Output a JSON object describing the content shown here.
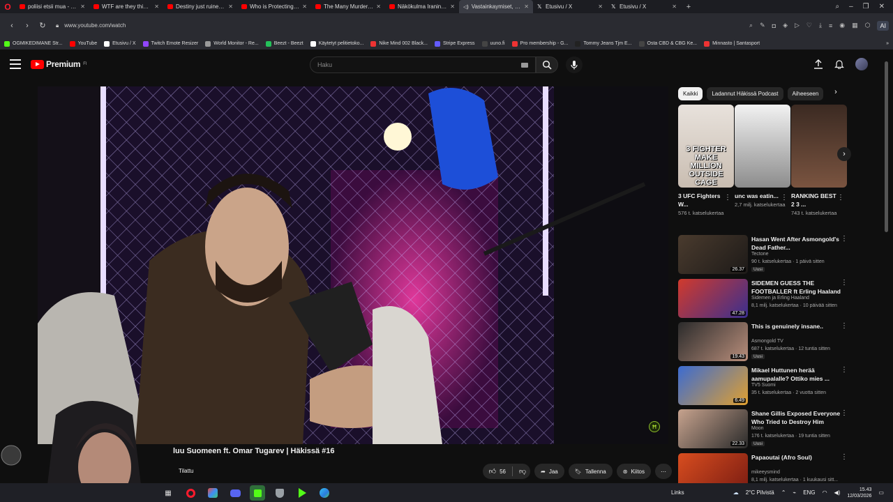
{
  "browser": {
    "tabs": [
      {
        "title": "poliisi etsii mua - YouTube",
        "icon": "youtube-icon",
        "active": false
      },
      {
        "title": "WTF are they thinking? - Y",
        "icon": "youtube-icon",
        "active": false
      },
      {
        "title": "Destiny just ruined his ca",
        "icon": "youtube-icon",
        "active": false
      },
      {
        "title": "Who is Protecting the Jeff",
        "icon": "youtube-icon",
        "active": false
      },
      {
        "title": "The Many Murders of Jeff",
        "icon": "youtube-icon",
        "active": false
      },
      {
        "title": "Näkökulma Iranin tapaht",
        "icon": "youtube-icon",
        "active": false
      },
      {
        "title": "Vastainkaymiset, UFC",
        "icon": "audio-icon",
        "active": true
      },
      {
        "title": "Etusivu / X",
        "icon": "x-icon",
        "active": false
      },
      {
        "title": "Etusivu / X",
        "icon": "x-icon",
        "active": false
      }
    ],
    "url": "www.youtube.com/watch",
    "ai_label": "AI",
    "bookmarks": [
      {
        "label": "OGMIKEDIMANE Str...",
        "color": "#53fc18"
      },
      {
        "label": "YouTube",
        "color": "#ff0000"
      },
      {
        "label": "Etusivu / X",
        "color": "#ffffff"
      },
      {
        "label": "Twitch Emote Resizer",
        "color": "#9146ff"
      },
      {
        "label": "World Monitor - Re...",
        "color": "#999999"
      },
      {
        "label": "Beezt - Beezt",
        "color": "#24c15a"
      },
      {
        "label": "Käytetyt pelitietoko...",
        "color": "#ffffff"
      },
      {
        "label": "Nike Mind 002 Black...",
        "color": "#e33"
      },
      {
        "label": "Stripe Express",
        "color": "#635bff"
      },
      {
        "label": "uuno.fi",
        "color": "#444"
      },
      {
        "label": "Pro membership - G...",
        "color": "#e33"
      },
      {
        "label": "Tommy Jeans Tjm E...",
        "color": "#222"
      },
      {
        "label": "Osta CBD & CBG Ke...",
        "color": "#444"
      },
      {
        "label": "Minnasto | Santasport",
        "color": "#e33"
      }
    ]
  },
  "youtube": {
    "logo_text": "Premium",
    "logo_sup": "FI",
    "search_placeholder": "Haku",
    "video": {
      "title": "luu Suomeen ft. Omar Tugarev | Häkissä #16",
      "subscribe_label": "Tilattu",
      "like_count": "56",
      "share_label": "Jaa",
      "save_label": "Tallenna",
      "thanks_label": "Kiitos"
    },
    "chips": [
      {
        "label": "Kaikki",
        "on": true
      },
      {
        "label": "Ladannut Häkissä Podcast",
        "on": false
      },
      {
        "label": "Aiheeseen",
        "on": false
      }
    ],
    "shorts": [
      {
        "title": "3 UFC Fighters W...",
        "views": "576 t. katselukertaa",
        "overlay": "3 FIGHTER MAKE MILLION OUTSIDE CAGE"
      },
      {
        "title": "unc was eatin...",
        "views": "2,7 milj. katselukertaa",
        "overlay": ""
      },
      {
        "title": "RANKING BEST 2 3 ...",
        "views": "743 t. katselukertaa",
        "overlay": ""
      }
    ],
    "recommended": [
      {
        "title": "Hasan Went After Asmongold's Dead Father...",
        "channel": "Tectone",
        "meta": "90 t. katselukertaa · 1 päivä sitten",
        "duration": "26.37",
        "badge": "Uusi"
      },
      {
        "title": "SIDEMEN GUESS THE FOOTBALLER ft Erling Haaland",
        "channel": "Sidemen ja Erling Haaland",
        "meta": "8,1 milj. katselukertaa · 10 päivää sitten",
        "duration": "47.28",
        "badge": ""
      },
      {
        "title": "This is genuinely insane..",
        "channel": "Asmongold TV",
        "meta": "687 t. katselukertaa · 12 tuntia sitten",
        "duration": "19.43",
        "badge": "Uusi"
      },
      {
        "title": "Mikael Huttunen herää aamupalalle? Ottiko mies ...",
        "channel": "TV5 Suomi",
        "meta": "35 t. katselukertaa · 2 vuotta sitten",
        "duration": "6.49",
        "badge": ""
      },
      {
        "title": "Shane Gillis Exposed Everyone Who Tried to Destroy Him",
        "channel": "Moon",
        "meta": "176 t. katselukertaa · 19 tuntia sitten",
        "duration": "22.33",
        "badge": "Uusi"
      },
      {
        "title": "Papaoutai (Afro Soul)",
        "channel": "mikeeysmind",
        "meta": "8,1 milj. katselukertaa · 1 kuukausi sitt...",
        "duration": "",
        "badge": ""
      }
    ]
  },
  "taskbar": {
    "links_label": "Links",
    "weather": "2°C Pilvistä",
    "lang": "ENG",
    "time": "15.43",
    "date": "12/03/2026"
  }
}
